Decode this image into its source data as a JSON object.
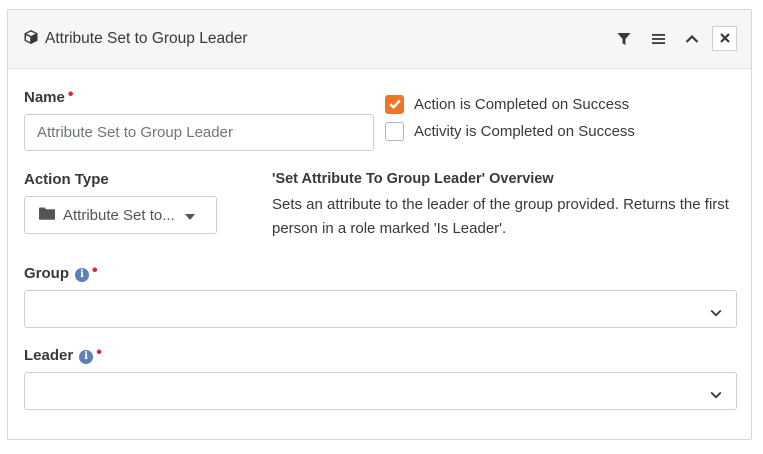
{
  "header": {
    "title": "Attribute Set to Group Leader",
    "icons": [
      "cube-icon",
      "filter-icon",
      "menu-icon",
      "collapse-icon",
      "close-icon"
    ]
  },
  "name_field": {
    "label": "Name",
    "value": "Attribute Set to Group Leader"
  },
  "checkboxes": [
    {
      "label": "Action is Completed on Success",
      "checked": true
    },
    {
      "label": "Activity is Completed on Success",
      "checked": false
    }
  ],
  "action_type": {
    "label": "Action Type",
    "value": "Attribute Set to..."
  },
  "overview": {
    "title": "'Set Attribute To Group Leader' Overview",
    "text": "Sets an attribute to the leader of the group provided. Returns the first person in a role marked 'Is Leader'."
  },
  "group_field": {
    "label": "Group",
    "value": ""
  },
  "leader_field": {
    "label": "Leader",
    "value": ""
  },
  "colors": {
    "accent": "#ee7625",
    "required": "#e0262e",
    "info": "#5b82b8"
  }
}
